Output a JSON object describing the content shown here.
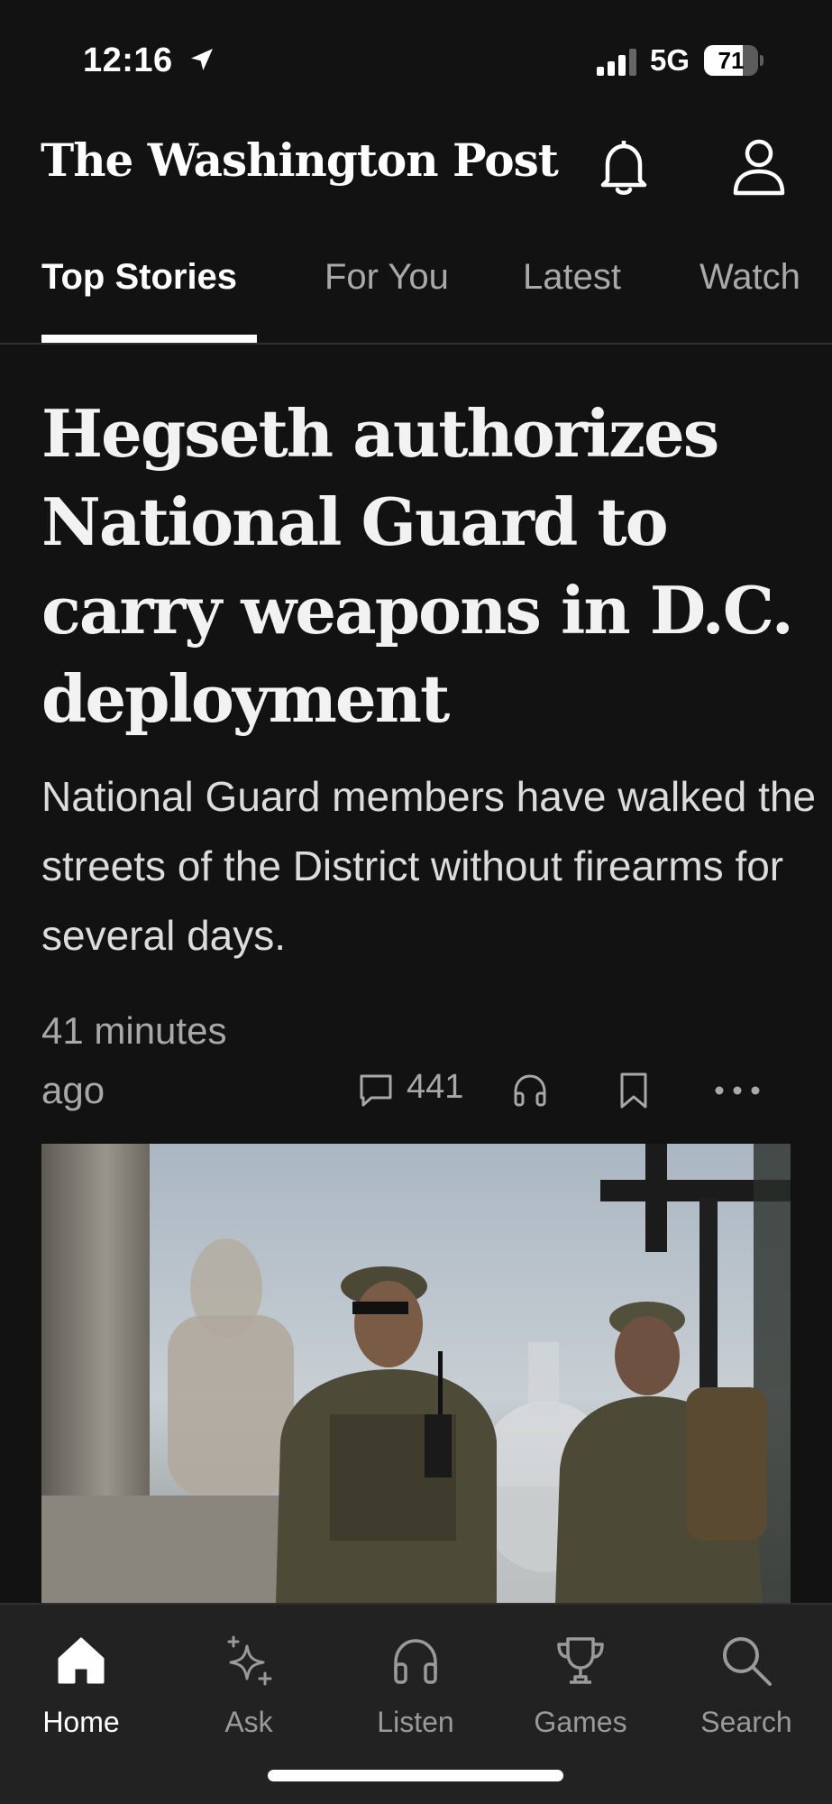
{
  "status_bar": {
    "time": "12:16",
    "network": "5G",
    "battery": "71",
    "battery_level": 0.71,
    "icons": [
      "location-arrow-icon",
      "signal-bars-icon",
      "battery-icon"
    ]
  },
  "header": {
    "masthead": "The Washington Post",
    "icons": [
      "bell-icon",
      "profile-icon"
    ]
  },
  "tabs": [
    {
      "label": "Top Stories",
      "active": true
    },
    {
      "label": "For You",
      "active": false
    },
    {
      "label": "Latest",
      "active": false
    },
    {
      "label": "Watch",
      "active": false
    }
  ],
  "article": {
    "headline": "Hegseth authorizes National Guard to carry weapons in D.C. deployment",
    "subhead": "National Guard members have walked the streets of the District without firearms for several days.",
    "timestamp": "41 minutes ago",
    "comment_count": "441",
    "action_icons": [
      "comment-icon",
      "headphones-icon",
      "bookmark-icon",
      "more-icon"
    ]
  },
  "bottom_nav": [
    {
      "label": "Home",
      "icon": "home-icon",
      "active": true
    },
    {
      "label": "Ask",
      "icon": "sparkle-icon",
      "active": false
    },
    {
      "label": "Listen",
      "icon": "headphones-icon",
      "active": false
    },
    {
      "label": "Games",
      "icon": "trophy-icon",
      "active": false
    },
    {
      "label": "Search",
      "icon": "search-icon",
      "active": false
    }
  ],
  "colors": {
    "background": "#121212",
    "nav_background": "#222222",
    "active_text": "#ffffff",
    "muted_text": "#a9a9a9"
  }
}
